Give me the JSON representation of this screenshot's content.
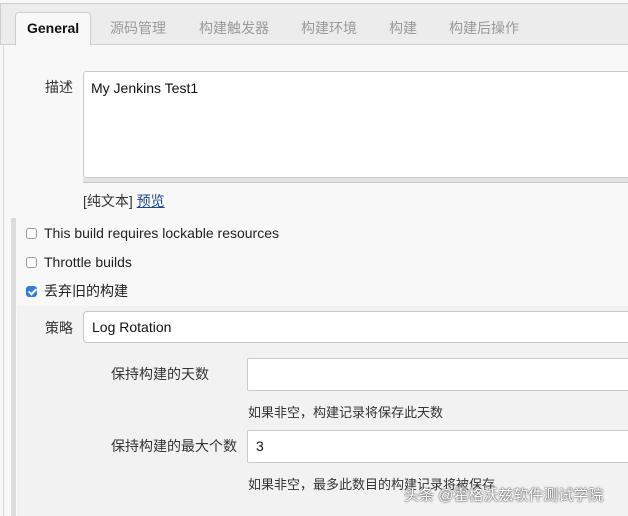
{
  "tabs": [
    {
      "label": "General",
      "active": true
    },
    {
      "label": "源码管理",
      "active": false
    },
    {
      "label": "构建触发器",
      "active": false
    },
    {
      "label": "构建环境",
      "active": false
    },
    {
      "label": "构建",
      "active": false
    },
    {
      "label": "构建后操作",
      "active": false
    }
  ],
  "description": {
    "label": "描述",
    "value": "My Jenkins Test1",
    "format_prefix": "[纯文本]",
    "preview_link": "预览"
  },
  "options": [
    {
      "label": "This build requires lockable resources",
      "checked": false
    },
    {
      "label": "Throttle builds",
      "checked": false
    },
    {
      "label": "丢弃旧的构建",
      "checked": true
    }
  ],
  "discard": {
    "strategy_label": "策略",
    "strategy_value": "Log Rotation",
    "days_label": "保持构建的天数",
    "days_value": "",
    "days_help": "如果非空，构建记录将保存此天数",
    "max_label": "保持构建的最大个数",
    "max_value": "3",
    "max_help": "如果非空，最多此数目的构建记录将被保存"
  },
  "watermark": "头条 @霍格沃兹软件测试学院",
  "colors": {
    "accent_checkbox": "#2f7ddc",
    "link": "#204a87"
  }
}
